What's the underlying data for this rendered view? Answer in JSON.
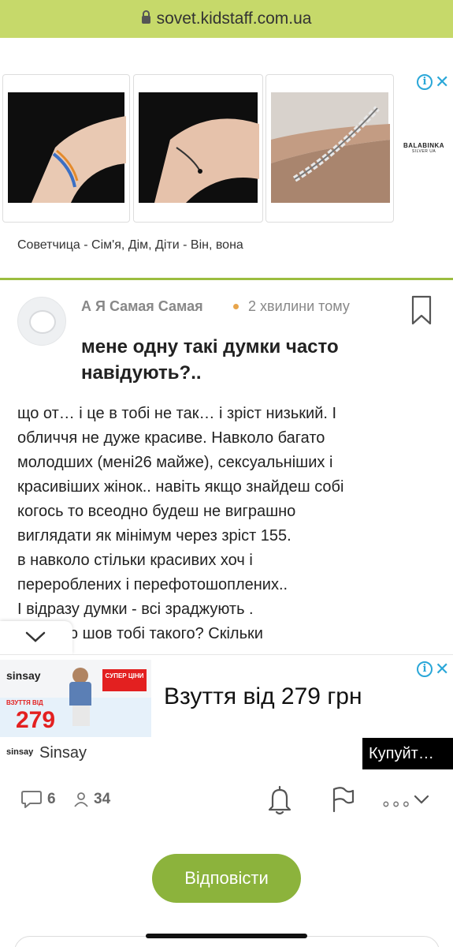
{
  "browser": {
    "url": "sovet.kidstaff.com.ua"
  },
  "top_ad": {
    "brand": "BALABINKA",
    "brand_sub": "SILVER UA",
    "caption": "Советчица - Сім'я, Дім, Діти - Він, вона",
    "ad_choices_icon": "info-icon",
    "close_icon": "close-icon"
  },
  "post": {
    "author": "А Я Самая Самая",
    "time": "2 хвилини тому",
    "title": "мене одну такі думки часто навідують?..",
    "body_lines": [
      "що от… і це в тобі не так… і зріст низький. І",
      "обличчя не дуже красиве. Навколо багато",
      "молодших (мені26 майже), сексуальніших і",
      "красивіших жінок.. навіть якщо знайдеш собі",
      "когось то всеодно будеш не виграшно",
      "виглядати як мінімум через зріст 155.",
      "в навколо стільки красивих хоч і",
      "перероблених і перефотошоплених..",
      "І відразу думки - всі зраджують .",
      "Я питаю шов тобі такого? Скільки"
    ]
  },
  "bottom_ad": {
    "logo": "sinsay",
    "sale_badge": "СУПЕР ЦІНИ",
    "small_label": "ВЗУТТЯ ВІД",
    "small_price": "279",
    "headline": "Взуття від 279 грн",
    "brand_name": "Sinsay",
    "cta": "Купуйт…"
  },
  "actions": {
    "comments": "6",
    "followers": "34"
  },
  "reply_button": "Відповісти",
  "colors": {
    "url_bar": "#c6d96a",
    "accent_green": "#8cb33c",
    "divider_green": "#9cbd3f",
    "adchoices_blue": "#2aa7d8",
    "dot_orange": "#e8a54b"
  }
}
